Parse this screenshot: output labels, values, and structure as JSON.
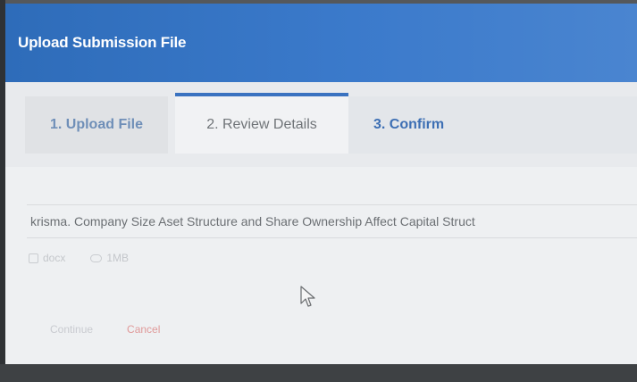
{
  "dialog": {
    "title": "Upload Submission File"
  },
  "tabs": [
    {
      "label": "1. Upload File"
    },
    {
      "label": "2. Review Details"
    },
    {
      "label": "3. Confirm"
    }
  ],
  "file": {
    "name": "krisma. Company Size Aset Structure and Share Ownership Affect Capital Struct",
    "type": "docx",
    "size": "1MB"
  },
  "actions": {
    "continue_label": "Continue",
    "cancel_label": "Cancel"
  },
  "colors": {
    "header": "#3b7acb",
    "active_tab_indicator": "#3a72c0",
    "cancel": "#e09a9a"
  }
}
